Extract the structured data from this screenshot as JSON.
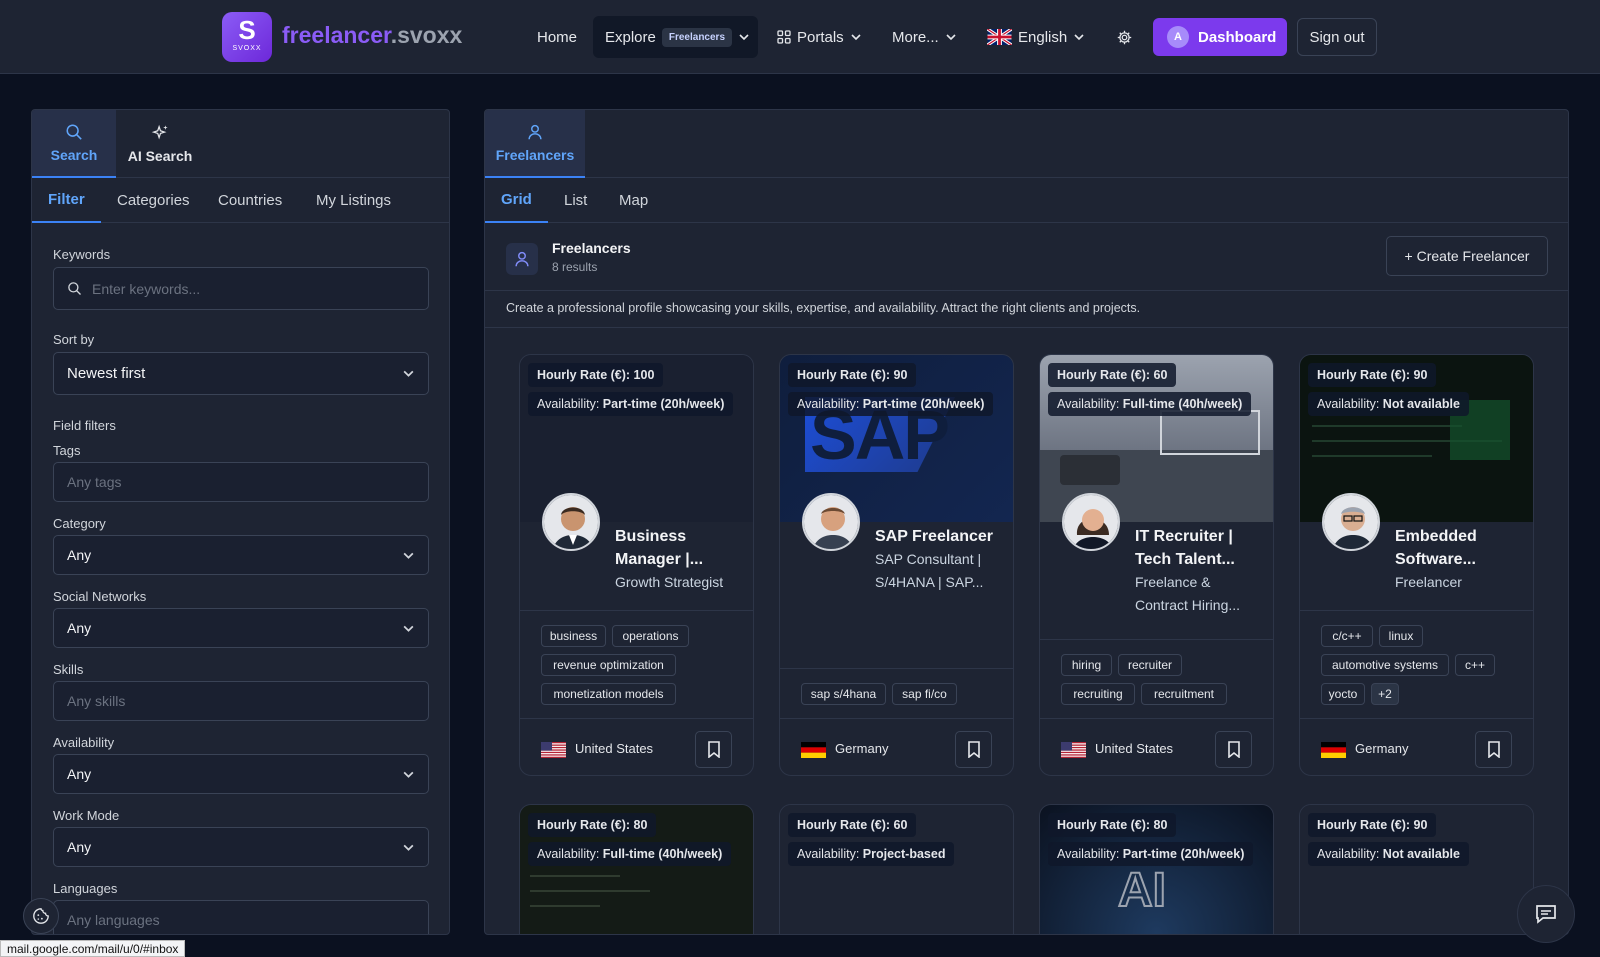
{
  "header": {
    "logo_letter": "S",
    "logo_small": "SVOXX",
    "brand_part1": "freelancer",
    "brand_part2": ".svoxx",
    "nav": {
      "home": "Home",
      "explore": "Explore",
      "explore_badge": "Freelancers",
      "portals": "Portals",
      "more": "More...",
      "language": "English"
    },
    "dashboard_avatar": "A",
    "dashboard": "Dashboard",
    "signout": "Sign out"
  },
  "sidebar": {
    "tabs": [
      {
        "label": "Search",
        "icon": "search-icon"
      },
      {
        "label": "AI Search",
        "icon": "sparkles-icon"
      }
    ],
    "subtabs": [
      "Filter",
      "Categories",
      "Countries",
      "My Listings"
    ],
    "filters": {
      "keywords_label": "Keywords",
      "keywords_placeholder": "Enter keywords...",
      "sort_label": "Sort by",
      "sort_value": "Newest first",
      "field_filters_label": "Field filters",
      "tags_label": "Tags",
      "tags_placeholder": "Any tags",
      "category_label": "Category",
      "category_value": "Any",
      "social_label": "Social Networks",
      "social_value": "Any",
      "skills_label": "Skills",
      "skills_placeholder": "Any skills",
      "availability_label": "Availability",
      "availability_value": "Any",
      "workmode_label": "Work Mode",
      "workmode_value": "Any",
      "languages_label": "Languages",
      "languages_placeholder": "Any languages"
    }
  },
  "main": {
    "tab": "Freelancers",
    "view_tabs": [
      "Grid",
      "List",
      "Map"
    ],
    "title": "Freelancers",
    "count": "8 results",
    "create_button": "+ Create Freelancer",
    "description": "Create a professional profile showcasing your skills, expertise, and availability. Attract the right clients and projects."
  },
  "cards": [
    {
      "rate": "Hourly Rate (€): 100",
      "availability_label": "Availability:",
      "availability": "Part-time (20h/week)",
      "title_line1": "Business",
      "title_line2": "Manager |...",
      "subtitle_line1": "Growth Strategist",
      "subtitle_line2": "",
      "tags": [
        "business",
        "operations",
        "revenue optimization",
        "monetization models"
      ],
      "country": "United States"
    },
    {
      "rate": "Hourly Rate (€): 90",
      "availability_label": "Availability:",
      "availability": "Part-time (20h/week)",
      "title_line1": "SAP Freelancer",
      "title_line2": "",
      "subtitle_line1": "SAP Consultant |",
      "subtitle_line2": "S/4HANA | SAP...",
      "tags": [
        "sap s/4hana",
        "sap fi/co"
      ],
      "country": "Germany",
      "banner_text": "SAP"
    },
    {
      "rate": "Hourly Rate (€): 60",
      "availability_label": "Availability:",
      "availability": "Full-time (40h/week)",
      "title_line1": "IT Recruiter |",
      "title_line2": "Tech Talent...",
      "subtitle_line1": "Freelance &",
      "subtitle_line2": "Contract Hiring...",
      "tags": [
        "hiring",
        "recruiter",
        "recruiting",
        "recruitment"
      ],
      "country": "United States"
    },
    {
      "rate": "Hourly Rate (€): 90",
      "availability_label": "Availability:",
      "availability": "Not available",
      "title_line1": "Embedded",
      "title_line2": "Software...",
      "subtitle_line1": "Freelancer",
      "subtitle_line2": "",
      "tags": [
        "c/c++",
        "linux",
        "automotive systems",
        "c++",
        "yocto",
        "+2"
      ],
      "country": "Germany"
    },
    {
      "rate": "Hourly Rate (€): 80",
      "availability_label": "Availability:",
      "availability": "Full-time (40h/week)"
    },
    {
      "rate": "Hourly Rate (€): 60",
      "availability_label": "Availability:",
      "availability": "Project-based"
    },
    {
      "rate": "Hourly Rate (€): 80",
      "availability_label": "Availability:",
      "availability": "Part-time (20h/week)",
      "banner_text": "AI"
    },
    {
      "rate": "Hourly Rate (€): 90",
      "availability_label": "Availability:",
      "availability": "Not available"
    }
  ],
  "status_url": "mail.google.com/mail/u/0/#inbox",
  "colors": {
    "accent": "#7c3aed",
    "link": "#60a5fa",
    "panel": "#1e2433",
    "background": "#0b1120"
  }
}
